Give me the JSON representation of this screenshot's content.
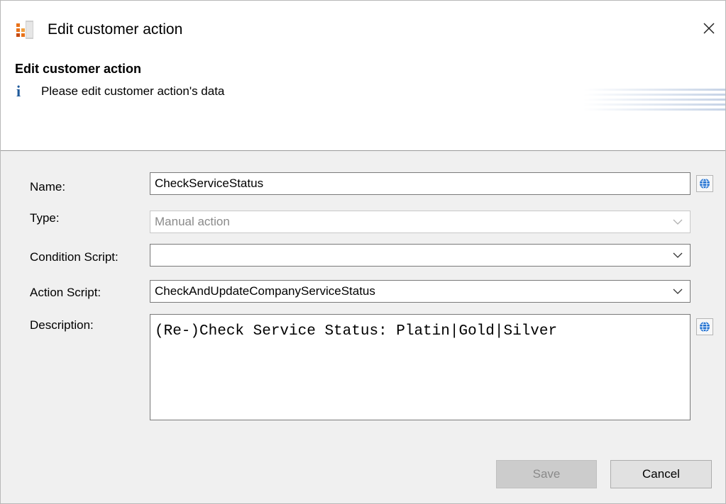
{
  "window": {
    "title": "Edit customer action",
    "close_glyph": "✕"
  },
  "header": {
    "title": "Edit customer action",
    "subtitle": "Please edit customer action's data",
    "info_glyph": "i"
  },
  "form": {
    "name": {
      "label": "Name:",
      "value": "CheckServiceStatus"
    },
    "type": {
      "label": "Type:",
      "value": "Manual action"
    },
    "condition_script": {
      "label": "Condition Script:",
      "value": ""
    },
    "action_script": {
      "label": "Action Script:",
      "value": "CheckAndUpdateCompanyServiceStatus"
    },
    "description": {
      "label": "Description:",
      "value": "(Re-)Check Service Status: Platin|Gold|Silver"
    }
  },
  "buttons": {
    "save_label": "Save",
    "cancel_label": "Cancel"
  },
  "icons": {
    "app": "app-icon",
    "info": "info-icon",
    "globe": "globe-icon",
    "chevron": "chevron-down-icon",
    "close": "close-icon"
  },
  "colors": {
    "info_blue": "#1f5a9b",
    "globe_blue": "#1e6fd0",
    "app_orange": "#e8731b"
  }
}
